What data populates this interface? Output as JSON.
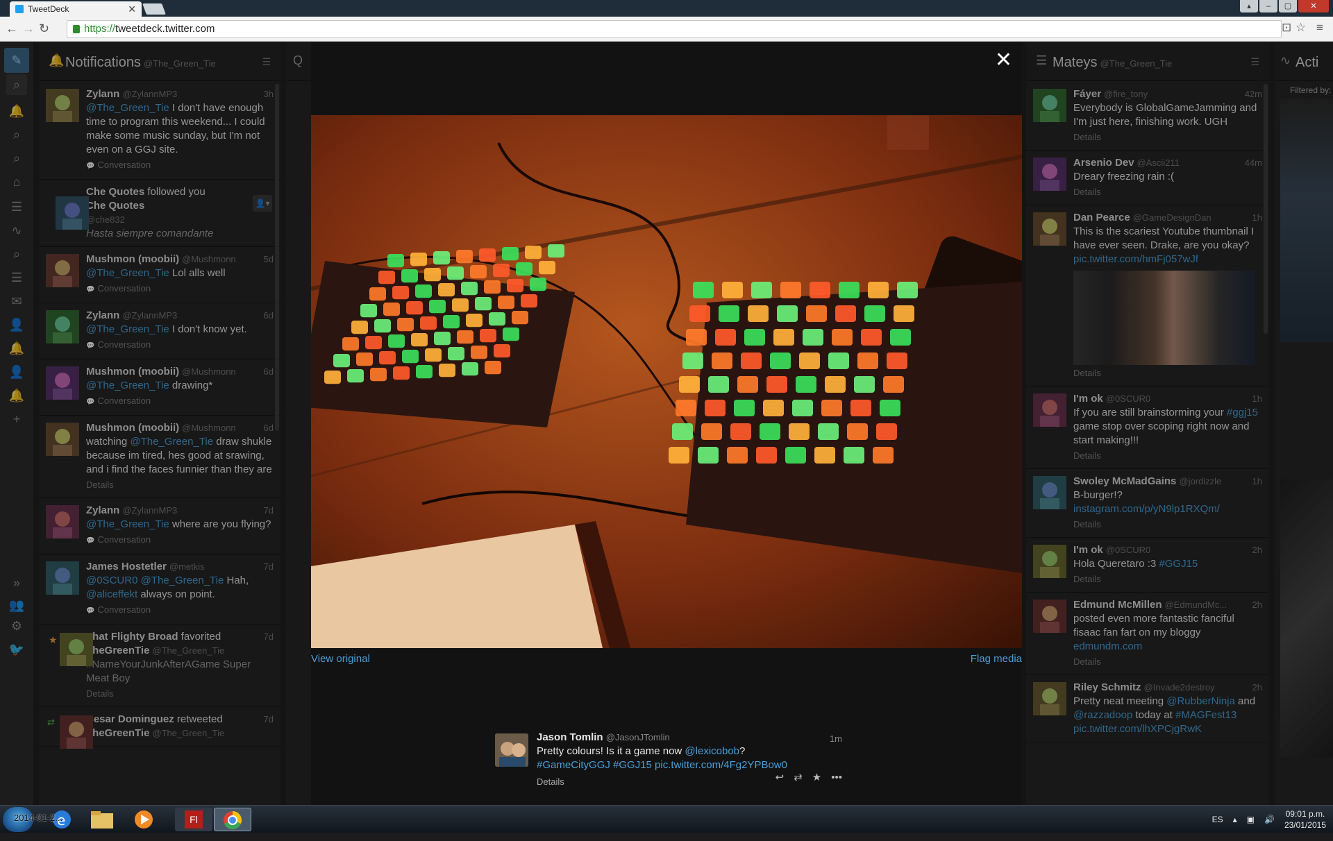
{
  "browser": {
    "tab_title": "TweetDeck",
    "url_scheme": "https://",
    "url_rest": "tweetdeck.twitter.com"
  },
  "sidebar_icons": [
    "compose-icon",
    "search-icon",
    "notifications-icon",
    "search-icon",
    "search-icon",
    "home-icon",
    "list-icon",
    "activity-icon",
    "search-icon",
    "list-icon",
    "messages-icon",
    "user-icon",
    "notifications-icon",
    "user-icon",
    "notifications-icon",
    "add-column-icon",
    "expand-icon",
    "accounts-icon",
    "settings-icon",
    "twitter-logo-icon"
  ],
  "notifications": {
    "title": "Notifications",
    "handle": "@The_Green_Tie",
    "items": [
      {
        "name": "Zylann",
        "handle": "@ZylannMP3",
        "time": "3h",
        "pre": "",
        "mention": "@The_Green_Tie",
        "text": " I don't have enough time to program this weekend... I could make some music sunday, but I'm not even on a GGJ site.",
        "meta": "Conversation"
      },
      {
        "type": "follow",
        "name": "Che Quotes",
        "verb": " followed you",
        "name2": "Che Quotes",
        "handle": "@che832",
        "bio": "Hasta siempre comandante"
      },
      {
        "name": "Mushmon (moobii)",
        "handle": "@Mushmonn",
        "time": "5d",
        "pre": "",
        "mention": "@The_Green_Tie",
        "text": " Lol alls well",
        "meta": "Conversation"
      },
      {
        "name": "Zylann",
        "handle": "@ZylannMP3",
        "time": "6d",
        "pre": "",
        "mention": "@The_Green_Tie",
        "text": " I don't know yet.",
        "meta": "Conversation"
      },
      {
        "name": "Mushmon (moobii)",
        "handle": "@Mushmonn",
        "time": "6d",
        "pre": "",
        "mention": "@The_Green_Tie",
        "text": " drawing*",
        "meta": "Conversation"
      },
      {
        "name": "Mushmon (moobii)",
        "handle": "@Mushmonn",
        "time": "6d",
        "pre": "watching ",
        "mention": "@The_Green_Tie",
        "text": " draw shukle because im tired, hes good at srawing, and i find the faces funnier than they are",
        "meta": "Details"
      },
      {
        "name": "Zylann",
        "handle": "@ZylannMP3",
        "time": "7d",
        "pre": "",
        "mention": "@The_Green_Tie",
        "text": " where are you flying?",
        "meta": "Conversation"
      },
      {
        "name": "James Hostetler",
        "handle": "@metkis",
        "time": "7d",
        "pre": "",
        "mention": "@0SCUR0 @The_Green_Tie",
        "text": " Hah, ",
        "mention2": "@aliceffekt",
        "text2": " always on point.",
        "meta": "Conversation"
      },
      {
        "type": "favorite",
        "actor": "That Flighty Broad",
        "verb": " favorited",
        "name": "TheGreenTie",
        "handle": "@The_Green_Tie",
        "time": "7d",
        "text": "#NameYourJunkAfterAGame Super Meat Boy",
        "meta": "Details"
      },
      {
        "type": "retweet",
        "actor": "Cesar Dominguez",
        "verb": " retweeted",
        "name": "TheGreenTie",
        "handle": "@The_Green_Tie",
        "time": "7d"
      }
    ]
  },
  "mateys": {
    "title": "Mateys",
    "handle": "@The_Green_Tie",
    "items": [
      {
        "name": "Fáyer",
        "handle": "@fire_tony",
        "time": "42m",
        "text": "Everybody is GlobalGameJamming and I'm just here, finishing work. UGH",
        "meta": "Details"
      },
      {
        "name": "Arsenio Dev",
        "handle": "@Ascii211",
        "time": "44m",
        "text": "Dreary freezing rain :(",
        "meta": "Details"
      },
      {
        "name": "Dan Pearce",
        "handle": "@GameDesignDan",
        "time": "1h",
        "text": "This is the scariest Youtube thumbnail I have ever seen. Drake, are you okay?",
        "link": "pic.twitter.com/hmFj057wJf",
        "has_media": true,
        "meta": "Details"
      },
      {
        "name": "I'm ok",
        "handle": "@0SCUR0",
        "time": "1h",
        "text": "If you are still brainstorming your ",
        "tag": "#ggj15",
        "text2": " game stop over scoping right now and start making!!!",
        "meta": "Details"
      },
      {
        "name": "Swoley McMadGains",
        "handle": "@jordizzle",
        "time": "1h",
        "text": "B-burger!?",
        "link": "instagram.com/p/yN9lp1RXQm/",
        "meta": "Details"
      },
      {
        "name": "I'm ok",
        "handle": "@0SCUR0",
        "time": "2h",
        "text": "Hola Queretaro :3 ",
        "tag": "#GGJ15",
        "meta": "Details"
      },
      {
        "name": "Edmund McMillen",
        "handle": "@EdmundMc...",
        "time": "2h",
        "text": "posted even more fantastic fanciful fisaac fan fart on my bloggy",
        "link": "edmundm.com",
        "meta": "Details"
      },
      {
        "name": "Riley Schmitz",
        "handle": "@Invade2destroy",
        "time": "2h",
        "text": "Pretty neat meeting ",
        "tag": "@RubberNinja",
        "text2": " and ",
        "tag2": "@razzadoop",
        "text3": " today at ",
        "tag3": "#MAGFest13",
        "link": "pic.twitter.com/lhXPCjgRwK"
      }
    ]
  },
  "activity": {
    "title": "Acti",
    "filtered": "Filtered by:"
  },
  "modal": {
    "view_original": "View original",
    "flag_media": "Flag media",
    "tweet": {
      "name": "Jason Tomlin",
      "handle": "@JasonJTomlin",
      "time": "1m",
      "text": "Pretty colours! Is it a game now ",
      "mention": "@lexicobob",
      "text2": "?",
      "tags": "#GameCityGGJ #GGJ15 pic.twitter.com/4Fg2YPBow0",
      "details": "Details"
    }
  },
  "taskbar": {
    "overlay_text": "2014-01-2...",
    "fl_label": "Fl",
    "lang": "ES",
    "time": "09:01 p.m.",
    "date": "23/01/2015"
  },
  "colors": {
    "link": "#4a9fd8",
    "accent": "#1da1f2"
  }
}
